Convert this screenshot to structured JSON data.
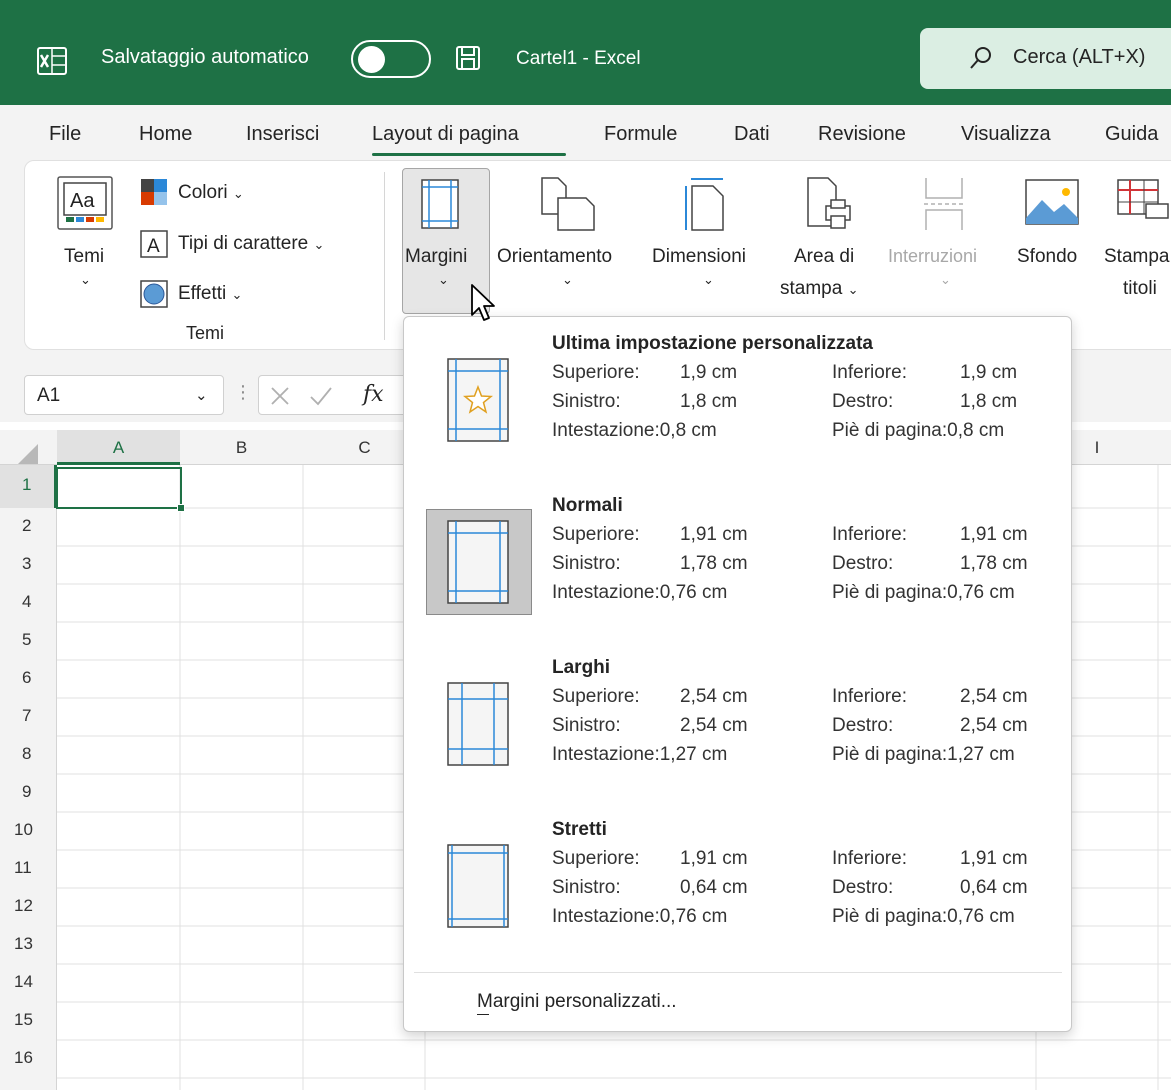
{
  "titlebar": {
    "autosave_label": "Salvataggio automatico",
    "doc_title": "Cartel1 - Excel",
    "search_text": "Cerca (ALT+X)",
    "brand_color": "#1e7145"
  },
  "tabs": [
    {
      "label": "File"
    },
    {
      "label": "Home"
    },
    {
      "label": "Inserisci"
    },
    {
      "label": "Layout di pagina",
      "active": true
    },
    {
      "label": "Formule"
    },
    {
      "label": "Dati"
    },
    {
      "label": "Revisione"
    },
    {
      "label": "Visualizza"
    },
    {
      "label": "Guida"
    }
  ],
  "ribbon": {
    "themes": {
      "temi_label": "Temi",
      "colori": "Colori",
      "tipi": "Tipi di carattere",
      "effetti": "Effetti",
      "group_label": "Temi"
    },
    "margini": "Margini",
    "orientamento": "Orientamento",
    "dimensioni": "Dimensioni",
    "area_line1": "Area di",
    "area_line2": "stampa",
    "interruzioni": "Interruzioni",
    "sfondo": "Sfondo",
    "stampa_line1": "Stampa",
    "stampa_line2": "titoli"
  },
  "formula_bar": {
    "name_box": "A1",
    "fx": "fx"
  },
  "grid": {
    "columns": [
      "A",
      "B",
      "C",
      "I"
    ],
    "rows": [
      "1",
      "2",
      "3",
      "4",
      "5",
      "6",
      "7",
      "8",
      "9",
      "10",
      "11",
      "12",
      "13",
      "14",
      "15",
      "16"
    ]
  },
  "margins_menu": {
    "options": [
      {
        "title": "Ultima impostazione personalizzata",
        "superiore_label": "Superiore:",
        "superiore": "1,9 cm",
        "inferiore_label": "Inferiore:",
        "inferiore": "1,9 cm",
        "sinistro_label": "Sinistro:",
        "sinistro": "1,8 cm",
        "destro_label": "Destro:",
        "destro": "1,8 cm",
        "intestazione": "Intestazione:0,8 cm",
        "pie": "Piè di pagina:0,8 cm"
      },
      {
        "title": "Normali",
        "superiore_label": "Superiore:",
        "superiore": "1,91 cm",
        "inferiore_label": "Inferiore:",
        "inferiore": "1,91 cm",
        "sinistro_label": "Sinistro:",
        "sinistro": "1,78 cm",
        "destro_label": "Destro:",
        "destro": "1,78 cm",
        "intestazione": "Intestazione:0,76 cm",
        "pie": "Piè di pagina:0,76 cm",
        "selected": true
      },
      {
        "title": "Larghi",
        "superiore_label": "Superiore:",
        "superiore": "2,54 cm",
        "inferiore_label": "Inferiore:",
        "inferiore": "2,54 cm",
        "sinistro_label": "Sinistro:",
        "sinistro": "2,54 cm",
        "destro_label": "Destro:",
        "destro": "2,54 cm",
        "intestazione": "Intestazione:1,27 cm",
        "pie": "Piè di pagina:1,27 cm"
      },
      {
        "title": "Stretti",
        "superiore_label": "Superiore:",
        "superiore": "1,91 cm",
        "inferiore_label": "Inferiore:",
        "inferiore": "1,91 cm",
        "sinistro_label": "Sinistro:",
        "sinistro": "0,64 cm",
        "destro_label": "Destro:",
        "destro": "0,64 cm",
        "intestazione": "Intestazione:0,76 cm",
        "pie": "Piè di pagina:0,76 cm"
      }
    ],
    "custom_margins_label": "Margini personalizzati..."
  }
}
